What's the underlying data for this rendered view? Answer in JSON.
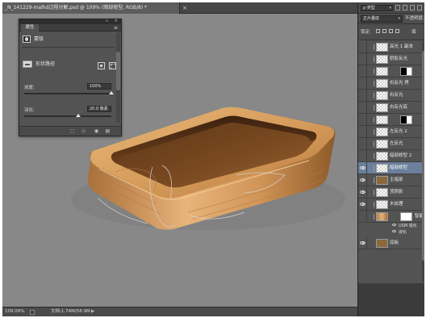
{
  "document": {
    "tab_title": "_N_141229-malhd过程分解.psd @ 109% (暗部修型, RGB/8) *",
    "close_glyph": "×"
  },
  "status": {
    "zoom": "109.09%",
    "doc_size": "文档:1.74M/58.9M",
    "arrow": "▶"
  },
  "properties_panel": {
    "title_tab": "属性",
    "collapse_glyph": "»",
    "close_glyph": "×",
    "menu_glyph": "≡",
    "mask_label": "蒙版",
    "shape_label": "形状路径",
    "density_label": "浓度:",
    "density_value": "100%",
    "density_level": 1.0,
    "feather_label": "羽化:",
    "feather_value": "20.0 像素",
    "feather_level": 0.62,
    "footer_icons": [
      "selection-icon",
      "apply-icon",
      "eye-icon",
      "trash-icon"
    ]
  },
  "layers_panel": {
    "kind_filter": "ρ 类型",
    "blend_mode": "正片叠底",
    "opacity_label": "不透明度:",
    "lock_label": "锁定:",
    "fill_label": "填",
    "layers": [
      {
        "name": "高光 1 副本",
        "visible": false,
        "selected": false,
        "thumb": "checker",
        "mask": null
      },
      {
        "name": "阴影反光",
        "visible": false,
        "selected": false,
        "thumb": "checker",
        "mask": null
      },
      {
        "name": "",
        "visible": false,
        "selected": false,
        "thumb": "checker",
        "mask": "black-white"
      },
      {
        "name": "右反光 拷",
        "visible": false,
        "selected": false,
        "thumb": "checker",
        "mask": null
      },
      {
        "name": "右反光",
        "visible": false,
        "selected": false,
        "thumb": "checker",
        "mask": null
      },
      {
        "name": "右反光底",
        "visible": false,
        "selected": false,
        "thumb": "checker",
        "mask": null
      },
      {
        "name": "",
        "visible": false,
        "selected": false,
        "thumb": "checker",
        "mask": "black-white"
      },
      {
        "name": "左反光 2",
        "visible": false,
        "selected": false,
        "thumb": "checker",
        "mask": null
      },
      {
        "name": "左反光",
        "visible": false,
        "selected": false,
        "thumb": "checker",
        "mask": null
      },
      {
        "name": "暗部修型 2",
        "visible": false,
        "selected": false,
        "thumb": "checker",
        "mask": null
      },
      {
        "name": "暗部修型",
        "visible": true,
        "selected": true,
        "thumb": "checker",
        "mask": null
      },
      {
        "name": "主暗部",
        "visible": true,
        "selected": false,
        "thumb": "solid",
        "mask": null
      },
      {
        "name": "顶阴影",
        "visible": true,
        "selected": false,
        "thumb": "checker",
        "mask": null
      },
      {
        "name": "木纹理",
        "visible": true,
        "selected": false,
        "thumb": "checker",
        "mask": null
      },
      {
        "name": "智能",
        "visible": false,
        "selected": false,
        "thumb": "wood",
        "mask": "white"
      }
    ],
    "sub_items": [
      "USM 锐化",
      "液化"
    ],
    "last_layer": "底板"
  }
}
